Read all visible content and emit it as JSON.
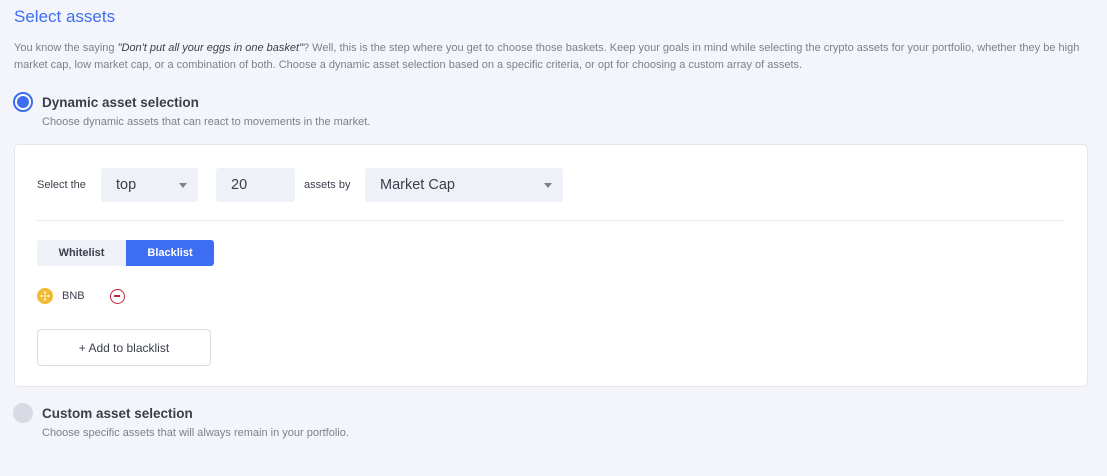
{
  "section": {
    "title": "Select assets",
    "intro_before": "You know the saying ",
    "intro_quote": "\"Don't put all your eggs in one basket\"",
    "intro_after": "? Well, this is the step where you get to choose those baskets. Keep your goals in mind while selecting the crypto assets for your portfolio, whether they be high market cap, low market cap, or a combination of both. Choose a dynamic asset selection based on a specific criteria, or opt for choosing a custom array of assets."
  },
  "dynamic_option": {
    "label": "Dynamic asset selection",
    "description": "Choose dynamic assets that can react to movements in the market.",
    "selected": true
  },
  "criteria": {
    "prefix_label": "Select the",
    "direction_value": "top",
    "count_value": "20",
    "middle_label": "assets by",
    "metric_value": "Market Cap"
  },
  "list_tabs": {
    "whitelist_label": "Whitelist",
    "blacklist_label": "Blacklist",
    "active": "Blacklist"
  },
  "blacklist_assets": [
    {
      "symbol": "BNB",
      "icon": "bnb-icon"
    }
  ],
  "add_button_label": "+ Add to blacklist",
  "custom_option": {
    "label": "Custom asset selection",
    "description": "Choose specific assets that will always remain in your portfolio.",
    "selected": false
  },
  "colors": {
    "accent": "#3d6df2",
    "background": "#f4f5fa",
    "remove": "#c0263b",
    "bnb": "#f3ba2f"
  }
}
